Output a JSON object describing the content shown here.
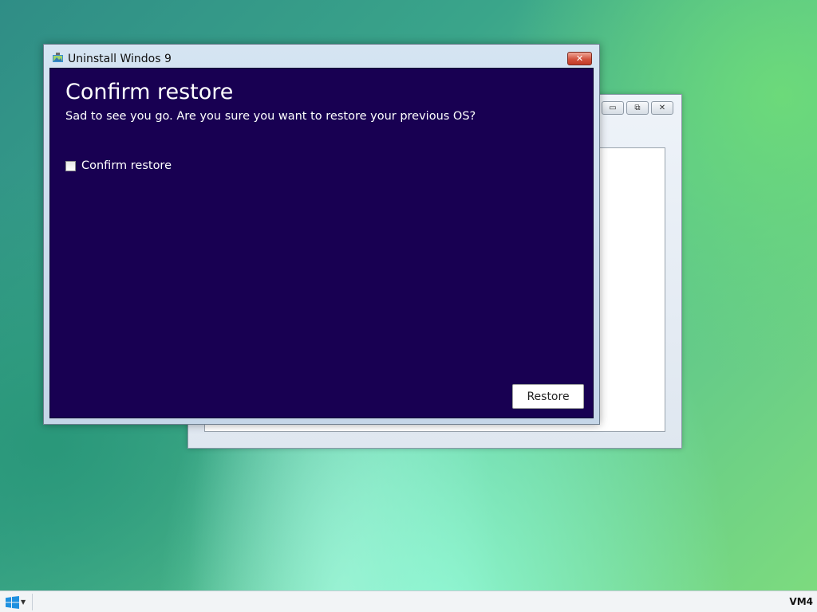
{
  "dialog": {
    "title": "Uninstall Windos 9",
    "heading": "Confirm restore",
    "subtitle": "Sad to see you go. Are you sure you want to restore your previous OS?",
    "checkbox_label": "Confirm restore",
    "checkbox_checked": false,
    "restore_button": "Restore",
    "close_glyph": "✕",
    "background_color": "#180052"
  },
  "background_window": {
    "minimize_glyph": "▭",
    "restore_glyph": "⧉",
    "close_glyph": "✕"
  },
  "taskbar": {
    "start_icon": "windows-logo-icon",
    "vm_label": "VM4"
  }
}
